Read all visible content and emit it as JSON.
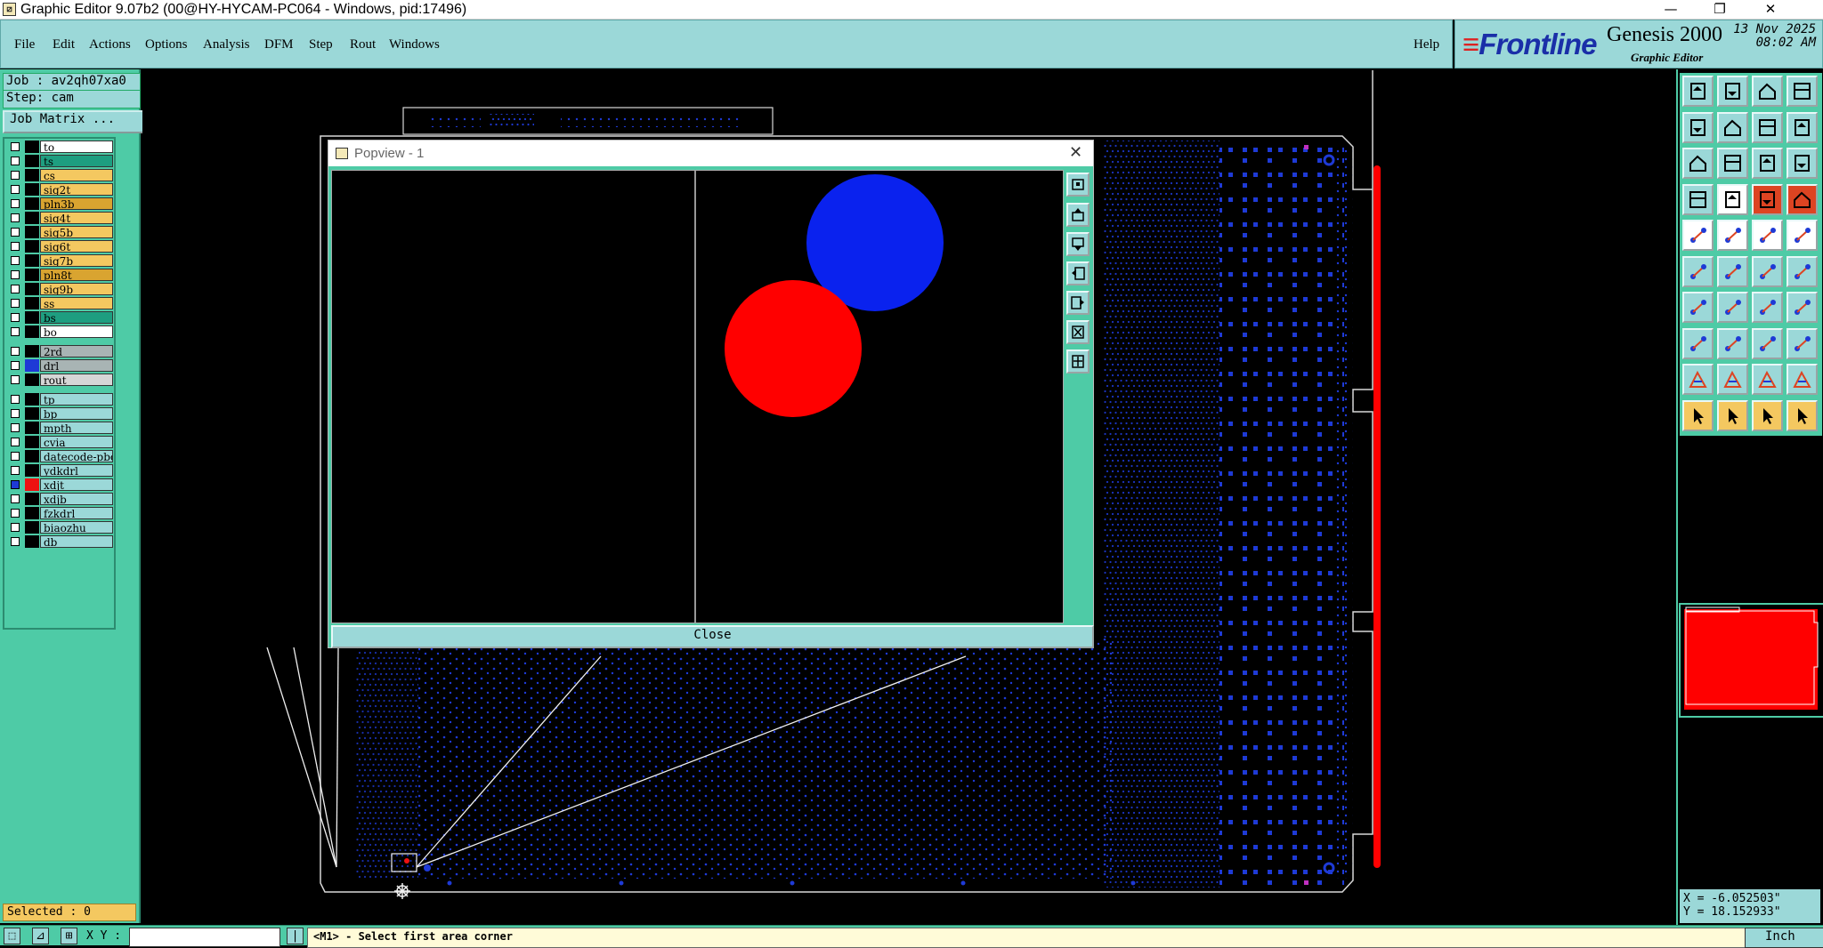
{
  "window": {
    "title": "Graphic Editor 9.07b2 (00@HY-HYCAM-PC064 - Windows, pid:17496)",
    "minimize": "—",
    "restore": "❐",
    "close": "✕"
  },
  "menu": {
    "items": [
      "File",
      "Edit",
      "Actions",
      "Options",
      "Analysis",
      "DFM",
      "Step",
      "Rout",
      "Windows"
    ],
    "help": "Help"
  },
  "brand": {
    "logo": "Frontline",
    "product": "Genesis 2000",
    "subtitle": "Graphic Editor",
    "date": "13 Nov 2025",
    "time": "08:02 AM"
  },
  "job": {
    "job_label": "Job : av2qh07xa0",
    "step_label": "Step: cam",
    "matrix_button": "Job Matrix ..."
  },
  "layers": [
    {
      "name": "to",
      "color": "#ffffff",
      "checked": false,
      "swatch": "#000000"
    },
    {
      "name": "ts",
      "color": "#1e9e80",
      "checked": false,
      "swatch": "#000000"
    },
    {
      "name": "cs",
      "color": "#f4c860",
      "checked": false,
      "swatch": "#000000"
    },
    {
      "name": "sig2t",
      "color": "#f4c860",
      "checked": false,
      "swatch": "#000000"
    },
    {
      "name": "pln3b",
      "color": "#d9a430",
      "checked": false,
      "swatch": "#000000"
    },
    {
      "name": "sig4t",
      "color": "#f4c860",
      "checked": false,
      "swatch": "#000000"
    },
    {
      "name": "sig5b",
      "color": "#f4c860",
      "checked": false,
      "swatch": "#000000"
    },
    {
      "name": "sig6t",
      "color": "#f4c860",
      "checked": false,
      "swatch": "#000000"
    },
    {
      "name": "sig7b",
      "color": "#f4c860",
      "checked": false,
      "swatch": "#000000"
    },
    {
      "name": "pln8t",
      "color": "#d9a430",
      "checked": false,
      "swatch": "#000000"
    },
    {
      "name": "sig9b",
      "color": "#f4c860",
      "checked": false,
      "swatch": "#000000"
    },
    {
      "name": "ss",
      "color": "#f4c860",
      "checked": false,
      "swatch": "#000000"
    },
    {
      "name": "bs",
      "color": "#1e9e80",
      "checked": false,
      "swatch": "#000000"
    },
    {
      "name": "bo",
      "color": "#ffffff",
      "checked": false,
      "swatch": "#000000"
    },
    {
      "name": "2rd",
      "color": "#a8b4b4",
      "checked": false,
      "swatch": "#000000",
      "gap": true
    },
    {
      "name": "drl",
      "color": "#a8b4b4",
      "checked": false,
      "swatch": "#1e3ad6"
    },
    {
      "name": "rout",
      "color": "#d6d6d6",
      "checked": false,
      "swatch": "#000000"
    },
    {
      "name": "tp",
      "color": "#9bd8d8",
      "checked": false,
      "swatch": "#000000",
      "gap": true
    },
    {
      "name": "bp",
      "color": "#9bd8d8",
      "checked": false,
      "swatch": "#000000"
    },
    {
      "name": "mpth",
      "color": "#9bd8d8",
      "checked": false,
      "swatch": "#000000"
    },
    {
      "name": "cvia",
      "color": "#9bd8d8",
      "checked": false,
      "swatch": "#000000"
    },
    {
      "name": "datecode-pbc",
      "color": "#9bd8d8",
      "checked": false,
      "swatch": "#000000"
    },
    {
      "name": "ydkdrl",
      "color": "#9bd8d8",
      "checked": false,
      "swatch": "#000000"
    },
    {
      "name": "xdjt",
      "color": "#9bd8d8",
      "checked": true,
      "swatch": "#e11"
    },
    {
      "name": "xdjb",
      "color": "#9bd8d8",
      "checked": false,
      "swatch": "#000000"
    },
    {
      "name": "fzkdrl",
      "color": "#9bd8d8",
      "checked": false,
      "swatch": "#000000"
    },
    {
      "name": "biaozhu",
      "color": "#9bd8d8",
      "checked": false,
      "swatch": "#000000"
    },
    {
      "name": "db",
      "color": "#9bd8d8",
      "checked": false,
      "swatch": "#000000"
    }
  ],
  "selected_label": "Selected : 0",
  "status": {
    "xy_label": "X Y :",
    "prompt": "<M1> - Select first area corner",
    "units": "Inch"
  },
  "coords": {
    "x": "X = -6.052503\"",
    "y": "Y = 18.152933\""
  },
  "popview": {
    "title": "Popview - 1",
    "close_button": "Close",
    "close_x": "✕"
  },
  "colors": {
    "accent_teal": "#4ecba6",
    "menu_bg": "#9bd8d8",
    "pcb_blue": "#1e3ad6",
    "highlight_red": "#ff0000"
  }
}
